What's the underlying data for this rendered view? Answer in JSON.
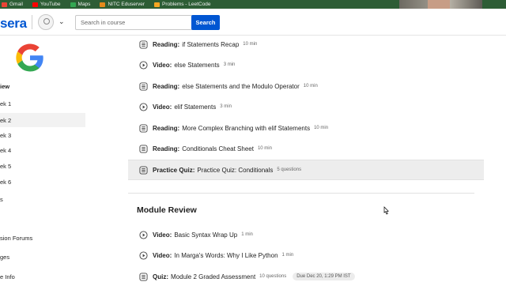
{
  "bookmarks": [
    {
      "label": "Gmail",
      "color": "#ea4335"
    },
    {
      "label": "YouTube",
      "color": "#ff0000"
    },
    {
      "label": "Maps",
      "color": "#34a853"
    },
    {
      "label": "NITC Eduserver",
      "color": "#e38a1c"
    },
    {
      "label": "Problems - LeetCode",
      "color": "#f5a623"
    }
  ],
  "header": {
    "brand": "sera",
    "search_placeholder": "Search in course",
    "search_button": "Search"
  },
  "sidebar": {
    "items": [
      {
        "label": "iew",
        "bold": true,
        "active": false
      },
      {
        "label": "ek 1",
        "bold": false,
        "active": false
      },
      {
        "label": "ek 2",
        "bold": false,
        "active": true
      },
      {
        "label": "ek 3",
        "bold": false,
        "active": false
      },
      {
        "label": "ek 4",
        "bold": false,
        "active": false
      },
      {
        "label": "ek 5",
        "bold": false,
        "active": false
      },
      {
        "label": "ek 6",
        "bold": false,
        "active": false
      },
      {
        "label": "s",
        "bold": false,
        "active": false
      },
      {
        "label": "sion Forums",
        "bold": false,
        "active": false
      },
      {
        "label": "ges",
        "bold": false,
        "active": false
      },
      {
        "label": "e Info",
        "bold": false,
        "active": false
      }
    ]
  },
  "main": {
    "items": [
      {
        "type": "reading",
        "kind": "Reading:",
        "title": "if Statements Recap",
        "meta": "10 min"
      },
      {
        "type": "video",
        "kind": "Video:",
        "title": "else Statements",
        "meta": "3 min"
      },
      {
        "type": "reading",
        "kind": "Reading:",
        "title": "else Statements and the Modulo Operator",
        "meta": "10 min"
      },
      {
        "type": "video",
        "kind": "Video:",
        "title": "elif Statements",
        "meta": "3 min"
      },
      {
        "type": "reading",
        "kind": "Reading:",
        "title": "More Complex Branching with elif Statements",
        "meta": "10 min"
      },
      {
        "type": "reading",
        "kind": "Reading:",
        "title": "Conditionals Cheat Sheet",
        "meta": "10 min"
      },
      {
        "type": "quiz",
        "kind": "Practice Quiz:",
        "title": "Practice Quiz: Conditionals",
        "meta": "5 questions",
        "hover": true
      }
    ],
    "section_title": "Module Review",
    "review_items": [
      {
        "type": "video",
        "kind": "Video:",
        "title": "Basic Syntax Wrap Up",
        "meta": "1 min"
      },
      {
        "type": "video",
        "kind": "Video:",
        "title": "In Marga's Words: Why I Like Python",
        "meta": "1 min"
      },
      {
        "type": "quiz",
        "kind": "Quiz:",
        "title": "Module 2 Graded Assessment",
        "meta": "10 questions",
        "due": "Due Dec 20, 1:29 PM IST"
      }
    ]
  }
}
